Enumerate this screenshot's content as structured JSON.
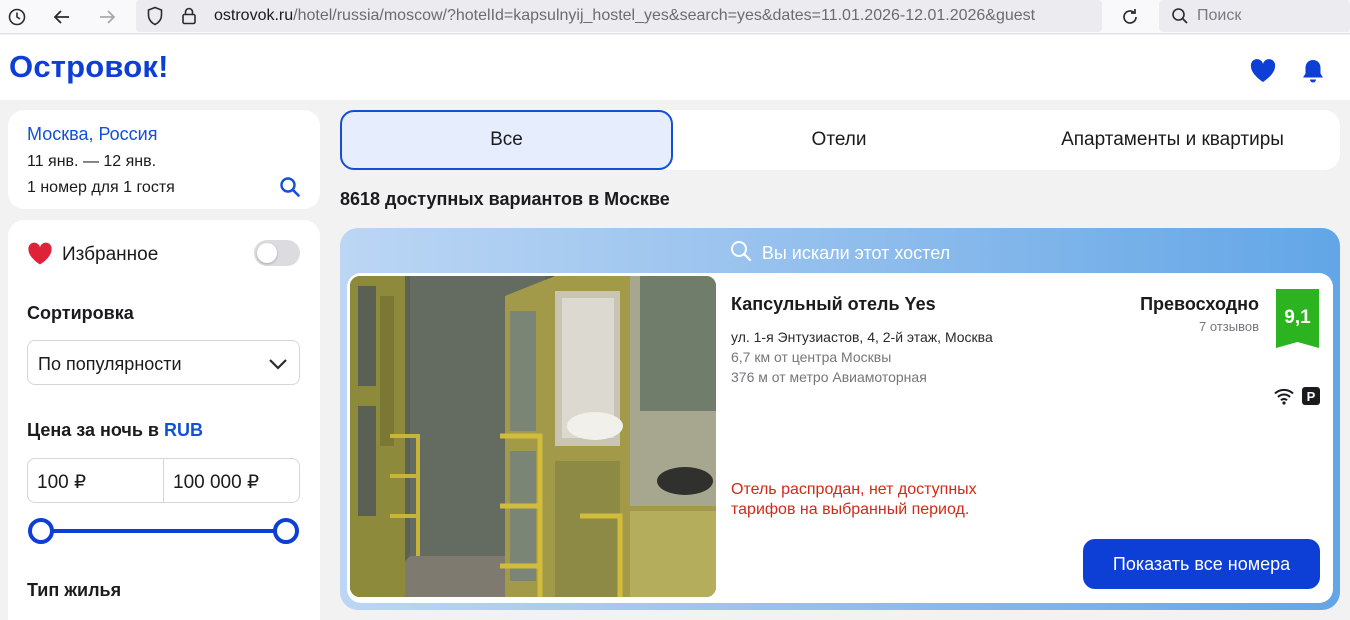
{
  "browser": {
    "url_host": "ostrovok.ru",
    "url_rest": "/hotel/russia/moscow/?hotelId=kapsulnyij_hostel_yes&search=yes&dates=11.01.2026-12.01.2026&guest",
    "search_placeholder": "Поиск"
  },
  "header": {
    "logo": "Островок!",
    "brand_color": "#0d3fd6"
  },
  "search_summary": {
    "city": "Москва, Россия",
    "dates": "11 янв. — 12 янв.",
    "guests": "1 номер для 1 гостя"
  },
  "filters": {
    "favorites_label": "Избранное",
    "favorites_on": false,
    "sort_title": "Сортировка",
    "sort_value": "По популярности",
    "price_title": "Цена за ночь в",
    "price_currency": "RUB",
    "price_min": "100 ₽",
    "price_max": "100 000 ₽",
    "housing_type_title": "Тип жилья"
  },
  "tabs": [
    {
      "label": "Все",
      "active": true
    },
    {
      "label": "Отели",
      "active": false
    },
    {
      "label": "Апартаменты и квартиры",
      "active": false
    }
  ],
  "results_count": "8618 доступных вариантов в Москве",
  "searched": {
    "title": "Вы искали этот хостел",
    "hotel": {
      "name": "Капсульный отель Yes",
      "address": "ул. 1-я Энтузиастов, 4, 2-й этаж, Москва",
      "distance": "6,7 км от центра Москвы",
      "metro": "376 м от метро Авиамоторная",
      "rating_word": "Превосходно",
      "reviews": "7 отзывов",
      "score": "9,1",
      "score_color": "#2bb320",
      "amenities": [
        "wifi-icon",
        "parking-icon"
      ],
      "soldout": "Отель распродан, нет доступных тарифов на выбранный период.",
      "soldout_color": "#d22a16",
      "cta": "Показать все номера"
    }
  }
}
